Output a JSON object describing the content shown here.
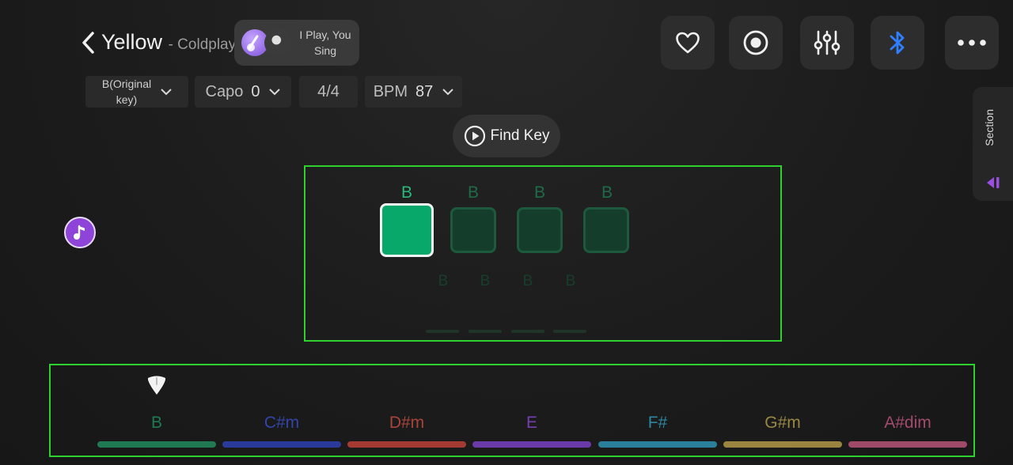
{
  "header": {
    "song_title": "Yellow",
    "song_artist": "- Coldplay",
    "mode_label_line1": "I Play, You",
    "mode_label_line2": "Sing"
  },
  "settings": {
    "key_line1": "B(Original",
    "key_line2": "key)",
    "capo_label": "Capo",
    "capo_value": "0",
    "time_signature": "4/4",
    "bpm_label": "BPM",
    "bpm_value": "87"
  },
  "find_key_label": "Find Key",
  "section_label": "Section",
  "current_bar": {
    "beats": [
      "B",
      "B",
      "B",
      "B"
    ],
    "active_beat": 1,
    "next_beats": [
      "B",
      "B",
      "B",
      "B"
    ]
  },
  "chord_strip": [
    {
      "name": "B",
      "color": "#1f7a53",
      "text_color": "#1f7a53"
    },
    {
      "name": "C#m",
      "color": "#2a3a9a",
      "text_color": "#3245a8"
    },
    {
      "name": "D#m",
      "color": "#a33b33",
      "text_color": "#a8453b"
    },
    {
      "name": "E",
      "color": "#6a3aa8",
      "text_color": "#7440b0"
    },
    {
      "name": "F#",
      "color": "#2a7f9a",
      "text_color": "#2e86a0"
    },
    {
      "name": "G#m",
      "color": "#9a8440",
      "text_color": "#9a8746"
    },
    {
      "name": "A#dim",
      "color": "#a04a6a",
      "text_color": "#a34b6c"
    }
  ],
  "icons": {
    "back": "chevron-left-icon",
    "favorite": "heart-icon",
    "record": "record-icon",
    "mixer": "sliders-icon",
    "bluetooth": "bluetooth-icon",
    "more": "more-icon",
    "music_note": "music-note-icon",
    "play": "play-icon"
  },
  "colors": {
    "accent_green": "#08a86a",
    "bluetooth_blue": "#2f7fff",
    "note_purple": "#8e44d8"
  }
}
